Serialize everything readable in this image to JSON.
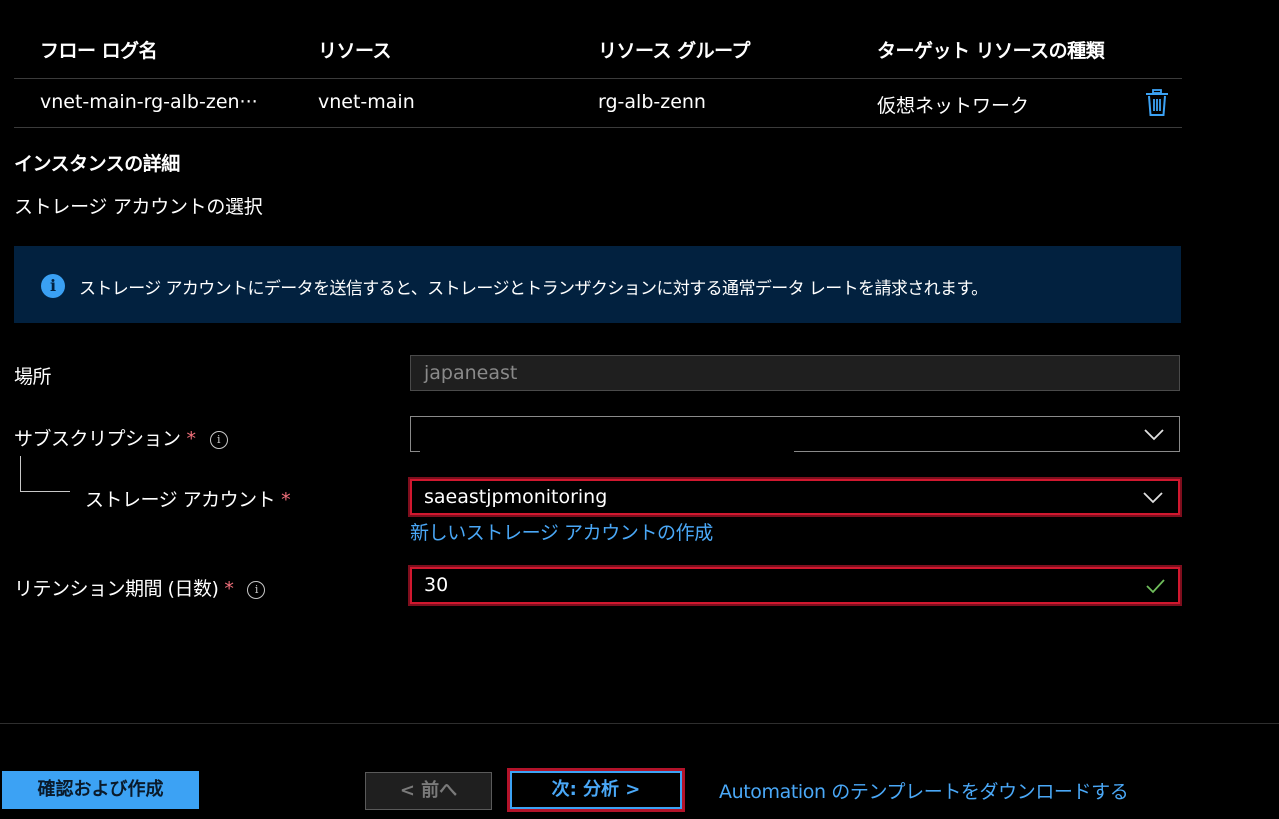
{
  "table": {
    "headers": [
      "フロー ログ名",
      "リソース",
      "リソース グループ",
      "ターゲット リソースの種類"
    ],
    "row": {
      "flow_log_name": "vnet-main-rg-alb-zen···",
      "resource": "vnet-main",
      "resource_group": "rg-alb-zenn",
      "target_type": "仮想ネットワーク",
      "delete_icon": "trash-icon"
    }
  },
  "instance": {
    "section_title": "インスタンスの詳細",
    "storage_select_title": "ストレージ アカウントの選択"
  },
  "info_banner": {
    "icon": "info-icon",
    "text": "ストレージ アカウントにデータを送信すると、ストレージとトランザクションに対する通常データ レートを請求されます。"
  },
  "form": {
    "location": {
      "label": "場所",
      "value": "japaneast"
    },
    "subscription": {
      "label": "サブスクリプション",
      "required_mark": "*",
      "info_icon": "i",
      "value": ""
    },
    "storage_account": {
      "label": "ストレージ アカウント",
      "required_mark": "*",
      "value": "saeastjpmonitoring",
      "create_link": "新しいストレージ アカウントの作成"
    },
    "retention": {
      "label": "リテンション期間 (日数)",
      "required_mark": "*",
      "info_icon": "i",
      "value": "30"
    }
  },
  "footer": {
    "review_create": "確認および作成",
    "prev": "< 前へ",
    "next": "次: 分析 >",
    "automation_link": "Automation のテンプレートをダウンロードする"
  },
  "colors": {
    "accent": "#3ca2f4",
    "highlight": "#d1182f",
    "info_bg": "#02213f",
    "valid": "#6fbd5b"
  }
}
